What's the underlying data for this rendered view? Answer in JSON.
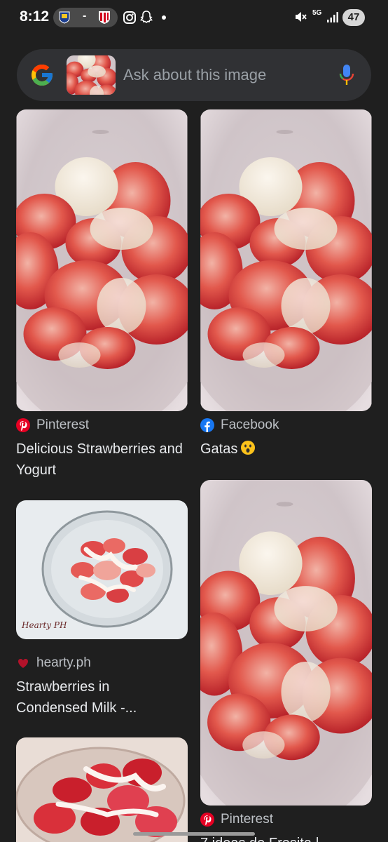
{
  "status_bar": {
    "time": "8:12",
    "pill_separator": "-",
    "network": "5G",
    "battery": "47"
  },
  "search": {
    "placeholder": "Ask about this image"
  },
  "results": [
    {
      "source": "Pinterest",
      "source_icon": "pinterest-icon",
      "title": "Delicious Strawberries and Yogurt"
    },
    {
      "source": "Facebook",
      "source_icon": "facebook-icon",
      "title": "Gatas"
    },
    {
      "source": "hearty.ph",
      "source_icon": "heart-icon",
      "title": "Strawberries in Condensed Milk -...",
      "image_watermark": "Hearty PH"
    },
    {
      "source": "Pinterest",
      "source_icon": "pinterest-icon",
      "title": "7 ideas de Fresita |"
    }
  ],
  "colors": {
    "background": "#1f1f1f",
    "search_bar": "#303134",
    "pinterest": "#e60023",
    "facebook": "#1877f2"
  }
}
